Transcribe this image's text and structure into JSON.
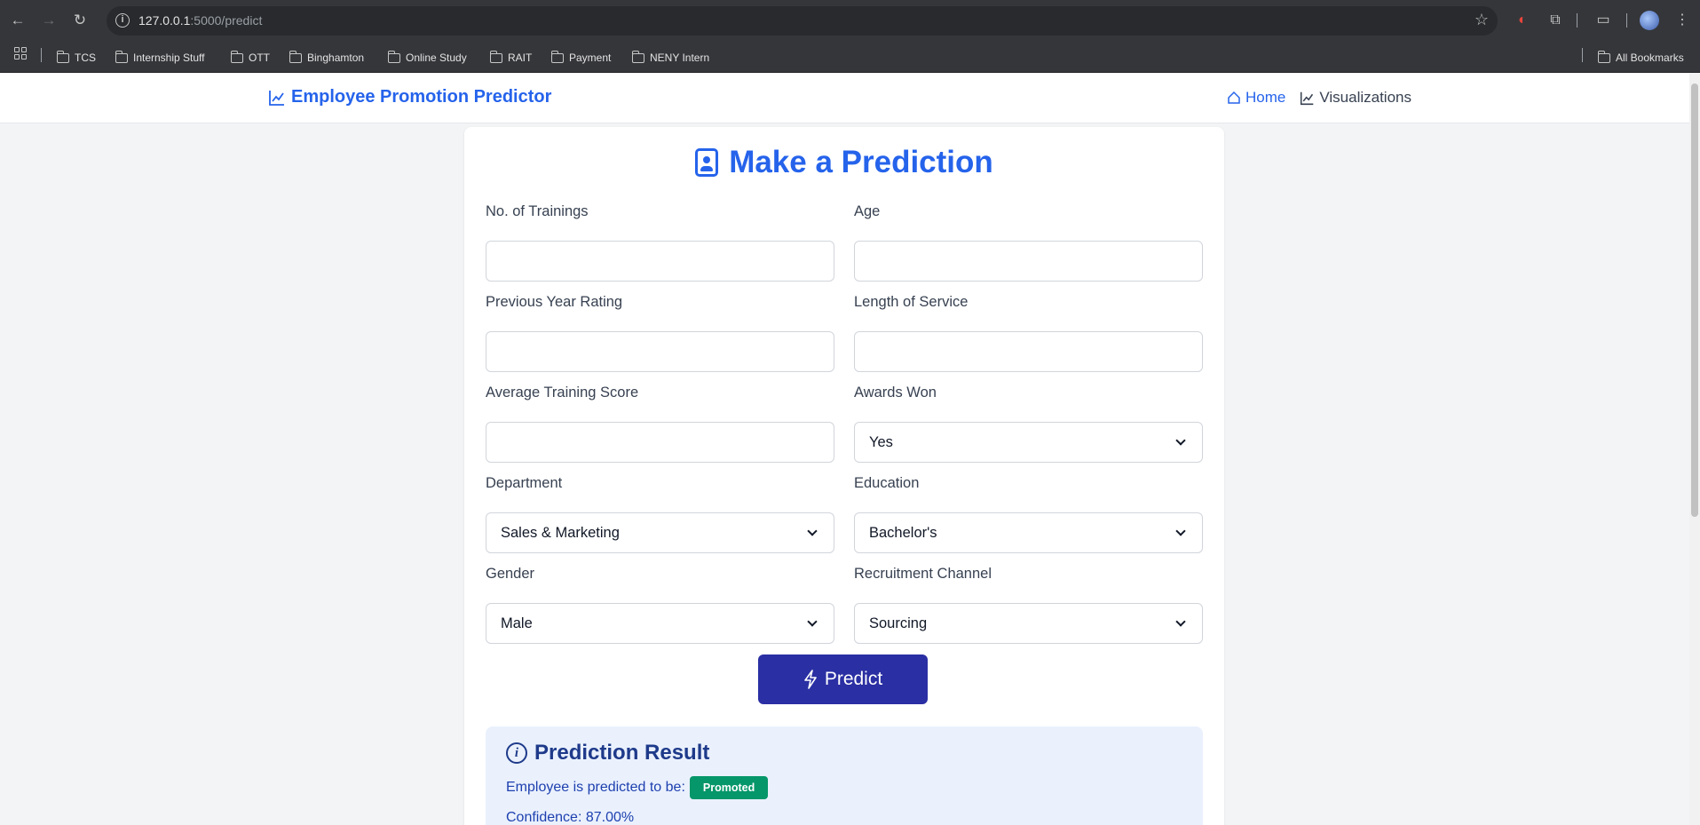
{
  "browser": {
    "url_host": "127.0.0.1",
    "url_path": ":5000/predict",
    "bookmarks": [
      "TCS",
      "Internship Stuff",
      "OTT",
      "Binghamton",
      "Online Study",
      "RAIT",
      "Payment",
      "NENY Intern"
    ],
    "all_bookmarks": "All Bookmarks"
  },
  "navbar": {
    "brand": "Employee Promotion Predictor",
    "links": [
      {
        "label": "Home",
        "icon": "home-icon",
        "active": true
      },
      {
        "label": "Visualizations",
        "icon": "chart-line-icon",
        "active": false
      }
    ]
  },
  "form": {
    "title": "Make a Prediction",
    "fields": {
      "trainings": {
        "label": "No. of Trainings",
        "value": ""
      },
      "age": {
        "label": "Age",
        "value": ""
      },
      "prev_rating": {
        "label": "Previous Year Rating",
        "value": ""
      },
      "service": {
        "label": "Length of Service",
        "value": ""
      },
      "avg_score": {
        "label": "Average Training Score",
        "value": ""
      },
      "awards": {
        "label": "Awards Won",
        "value": "Yes"
      },
      "department": {
        "label": "Department",
        "value": "Sales & Marketing"
      },
      "education": {
        "label": "Education",
        "value": "Bachelor's"
      },
      "gender": {
        "label": "Gender",
        "value": "Male"
      },
      "recruitment": {
        "label": "Recruitment Channel",
        "value": "Sourcing"
      }
    },
    "submit_label": "Predict"
  },
  "result": {
    "title": "Prediction Result",
    "prefix": "Employee is predicted to be:",
    "status": "Promoted",
    "status_color": "#059669",
    "confidence": "Confidence: 87.00%"
  },
  "colors": {
    "accent": "#2563eb",
    "button": "#2a2fa3"
  }
}
